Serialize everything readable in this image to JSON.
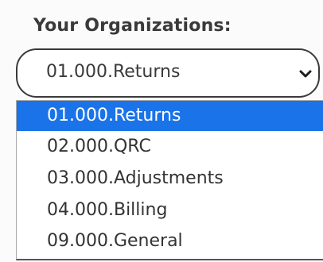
{
  "organizations": {
    "label": "Your Organizations:",
    "selected_value": "01.000.Returns",
    "chevron_icon": "chevron-down-icon",
    "selected_index": 0,
    "highlight_color": "#1a73e8",
    "options": [
      {
        "label": "01.000.Returns"
      },
      {
        "label": "02.000.QRC"
      },
      {
        "label": "03.000.Adjustments"
      },
      {
        "label": "04.000.Billing"
      },
      {
        "label": "09.000.General"
      }
    ]
  }
}
